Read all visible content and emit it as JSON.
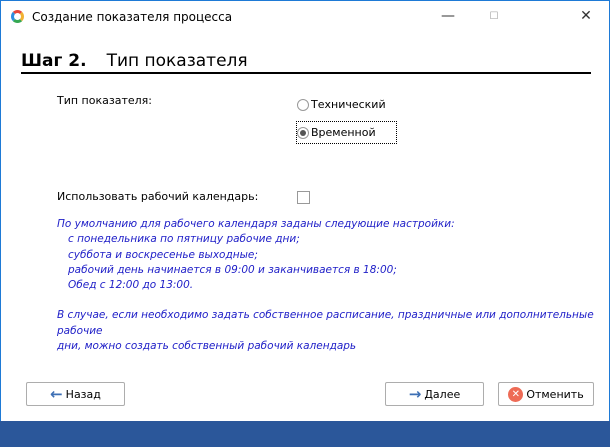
{
  "window": {
    "title": "Создание показателя процесса",
    "minimize": "—",
    "maximize": "☐",
    "close": "✕"
  },
  "header": {
    "step": "Шаг 2.",
    "title": "Тип показателя"
  },
  "indicator_type": {
    "label": "Тип показателя:",
    "options": [
      {
        "label": "Технический",
        "selected": false
      },
      {
        "label": "Временной",
        "selected": true
      }
    ]
  },
  "calendar": {
    "label": "Использовать рабочий календарь:",
    "checked": false
  },
  "info": {
    "line1": "По умолчанию для рабочего календаря заданы следующие настройки:",
    "line2": "с понедельника по пятницу рабочие дни;",
    "line3": "суббота и воскресенье выходные;",
    "line4": "рабочий день начинается в 09:00 и заканчивается в 18:00;",
    "line5": "Обед с 12:00 до 13:00.",
    "line6": "В случае, если необходимо задать собственное расписание, праздничные или дополнительные рабочие",
    "line7": "дни, можно создать собственный рабочий календарь"
  },
  "buttons": {
    "back": "Назад",
    "next": "Далее",
    "cancel": "Отменить",
    "back_icon": "←",
    "next_icon": "→",
    "cancel_icon": "✕"
  }
}
